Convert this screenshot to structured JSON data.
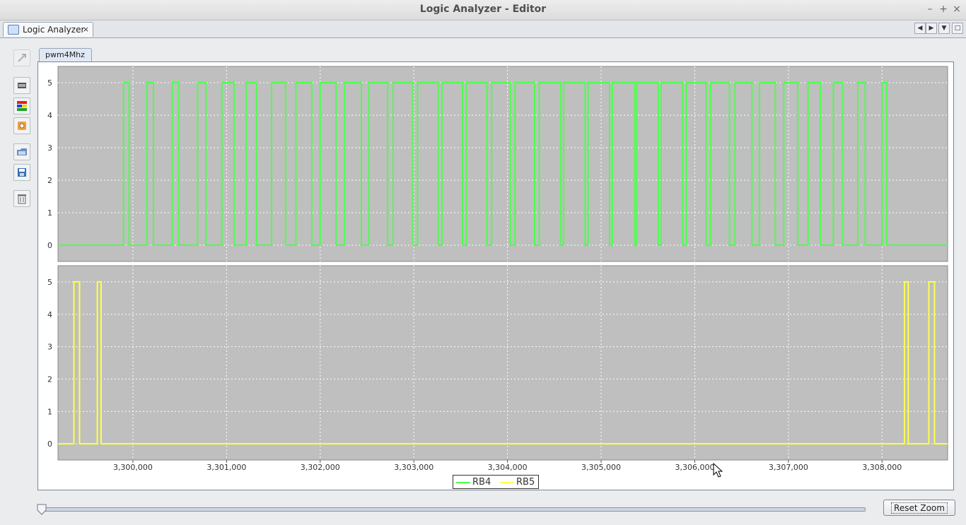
{
  "window": {
    "title": "Logic Analyzer - Editor",
    "controls": [
      "–",
      "+",
      "×"
    ]
  },
  "tabbar": {
    "tab_label": "Logic Analyzer",
    "tab_close": "×"
  },
  "toolbar": {
    "icons": [
      "select-icon",
      "chip-icon",
      "color-palette-icon",
      "settings-icon",
      "open-folder-icon",
      "save-icon",
      "trash-icon"
    ]
  },
  "main": {
    "tab_label": "pwm4Mhz",
    "reset_zoom_label": "Reset Zoom"
  },
  "slider": {
    "position": 0.0
  },
  "colors": {
    "plot_bg": "#bfbfbf",
    "rb4": "#4cff4c",
    "rb5": "#ffff4c"
  },
  "chart_data": {
    "type": "line",
    "x_range": [
      3299200,
      3308700
    ],
    "x_ticks": [
      "3,300,000",
      "3,301,000",
      "3,302,000",
      "3,303,000",
      "3,304,000",
      "3,305,000",
      "3,306,000",
      "3,307,000",
      "3,308,000"
    ],
    "x_tick_values": [
      3300000,
      3301000,
      3302000,
      3303000,
      3304000,
      3305000,
      3306000,
      3307000,
      3308000
    ],
    "y_ticks": [
      "0",
      "1",
      "2",
      "3",
      "4",
      "5"
    ],
    "legend": [
      "RB4",
      "RB5"
    ],
    "series": [
      {
        "name": "RB4",
        "color": "#4cff4c",
        "ylim": [
          -0.5,
          5.5
        ],
        "pulses": [
          [
            3299900,
            3299960
          ],
          [
            3300150,
            3300220
          ],
          [
            3300420,
            3300490
          ],
          [
            3300690,
            3300780
          ],
          [
            3300950,
            3301080
          ],
          [
            3301210,
            3301320
          ],
          [
            3301480,
            3301630
          ],
          [
            3301740,
            3301910
          ],
          [
            3302000,
            3302170
          ],
          [
            3302260,
            3302440
          ],
          [
            3302520,
            3302720
          ],
          [
            3302780,
            3302990
          ],
          [
            3303040,
            3303260
          ],
          [
            3303300,
            3303520
          ],
          [
            3303560,
            3303780
          ],
          [
            3303830,
            3304030
          ],
          [
            3304080,
            3304290
          ],
          [
            3304340,
            3304570
          ],
          [
            3304600,
            3304830
          ],
          [
            3304860,
            3305090
          ],
          [
            3305120,
            3305360
          ],
          [
            3305380,
            3305610
          ],
          [
            3305640,
            3305870
          ],
          [
            3305910,
            3306120
          ],
          [
            3306170,
            3306370
          ],
          [
            3306430,
            3306610
          ],
          [
            3306690,
            3306860
          ],
          [
            3306950,
            3307100
          ],
          [
            3307210,
            3307340
          ],
          [
            3307480,
            3307580
          ],
          [
            3307740,
            3307820
          ],
          [
            3308000,
            3308050
          ]
        ]
      },
      {
        "name": "RB5",
        "color": "#ffff4c",
        "ylim": [
          -0.5,
          5.5
        ],
        "pulses": [
          [
            3299370,
            3299430
          ],
          [
            3299620,
            3299660
          ],
          [
            3308240,
            3308280
          ],
          [
            3308500,
            3308560
          ]
        ]
      }
    ]
  }
}
